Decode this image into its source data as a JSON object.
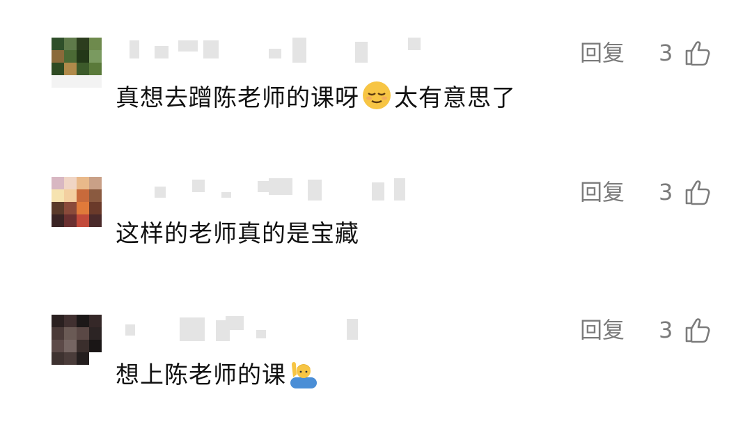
{
  "comments": [
    {
      "text_before": "真想去蹭陈老师的课呀",
      "emoji": "relieved-face-emoji",
      "text_after": "太有意思了",
      "reply_label": "回复",
      "like_count": "3",
      "like_icon": "thumbs-up-outline-icon",
      "avatar_colors": [
        "#2f4f2a",
        "#5f7a4a",
        "#2c3d1e",
        "#6e8a4d",
        "#8a6a3a",
        "#4b6a35",
        "#233818",
        "#7a9a60",
        "#2e4a22",
        "#b08a4a",
        "#3c5a2a",
        "#5a7a3a",
        "#f3f3f3",
        "#f3f3f3",
        "#f3f3f3",
        "#f3f3f3"
      ]
    },
    {
      "text": "这样的老师真的是宝藏",
      "reply_label": "回复",
      "like_count": "3",
      "like_icon": "thumbs-up-outline-icon",
      "avatar_colors": [
        "#d8b7c2",
        "#f0d5c5",
        "#e9b98a",
        "#c9a087",
        "#f6e3b0",
        "#f3cfa0",
        "#c86a3b",
        "#8a5a40",
        "#5a3a2a",
        "#8a4a3a",
        "#e07a3a",
        "#6a3a2a",
        "#3a2424",
        "#6a3030",
        "#c24a3a",
        "#4a2a2a"
      ]
    },
    {
      "text": "想上陈老师的课",
      "emoji": "person-raising-hand-emoji",
      "reply_label": "回复",
      "like_count": "3",
      "like_icon": "thumbs-up-outline-icon",
      "avatar_colors": [
        "#2a2020",
        "#403030",
        "#1c1818",
        "#352828",
        "#4a3a38",
        "#6a5a55",
        "#5a4845",
        "#2c2424",
        "#5c4a48",
        "#756562",
        "#3a2e2c",
        "#1a1616",
        "#3e3230",
        "#4a3c3a",
        "#241e1e",
        "#ffffff"
      ]
    }
  ]
}
